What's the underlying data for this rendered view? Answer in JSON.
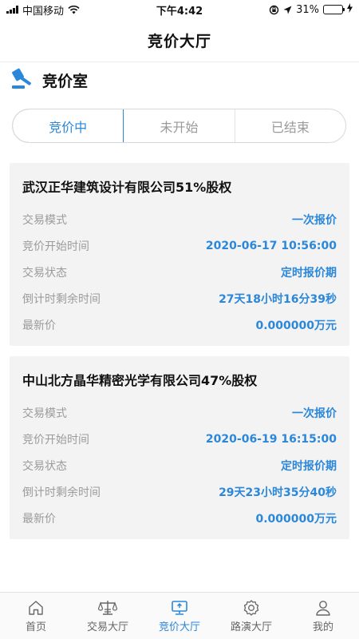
{
  "status_bar": {
    "carrier": "中国移动",
    "time": "下午4:42",
    "battery": "31%",
    "battery_level": 0.31
  },
  "nav": {
    "title": "竞价大厅"
  },
  "section": {
    "title": "竞价室",
    "icon": "gavel-icon"
  },
  "segments": [
    {
      "label": "竞价中",
      "active": true
    },
    {
      "label": "未开始",
      "active": false
    },
    {
      "label": "已结束",
      "active": false
    }
  ],
  "cards": [
    {
      "title": "武汉正华建筑设计有限公司51%股权",
      "rows": [
        {
          "key": "交易模式",
          "value": "一次报价"
        },
        {
          "key": "竞价开始时间",
          "value": "2020-06-17 10:56:00"
        },
        {
          "key": "交易状态",
          "value": "定时报价期"
        },
        {
          "key": "倒计时剩余时间",
          "value": "27天18小时16分39秒"
        },
        {
          "key": "最新价",
          "value": "0.000000万元"
        }
      ]
    },
    {
      "title": "中山北方晶华精密光学有限公司47%股权",
      "rows": [
        {
          "key": "交易模式",
          "value": "一次报价"
        },
        {
          "key": "竞价开始时间",
          "value": "2020-06-19 16:15:00"
        },
        {
          "key": "交易状态",
          "value": "定时报价期"
        },
        {
          "key": "倒计时剩余时间",
          "value": "29天23小时35分40秒"
        },
        {
          "key": "最新价",
          "value": "0.000000万元"
        }
      ]
    }
  ],
  "tabbar": [
    {
      "label": "首页",
      "icon": "home-icon"
    },
    {
      "label": "交易大厅",
      "icon": "scale-icon"
    },
    {
      "label": "竞价大厅",
      "icon": "monitor-icon",
      "active": true
    },
    {
      "label": "路演大厅",
      "icon": "gear-icon"
    },
    {
      "label": "我的",
      "icon": "user-icon"
    }
  ],
  "colors": {
    "accent": "#2b87d9",
    "card_bg": "#f3f3f3"
  }
}
